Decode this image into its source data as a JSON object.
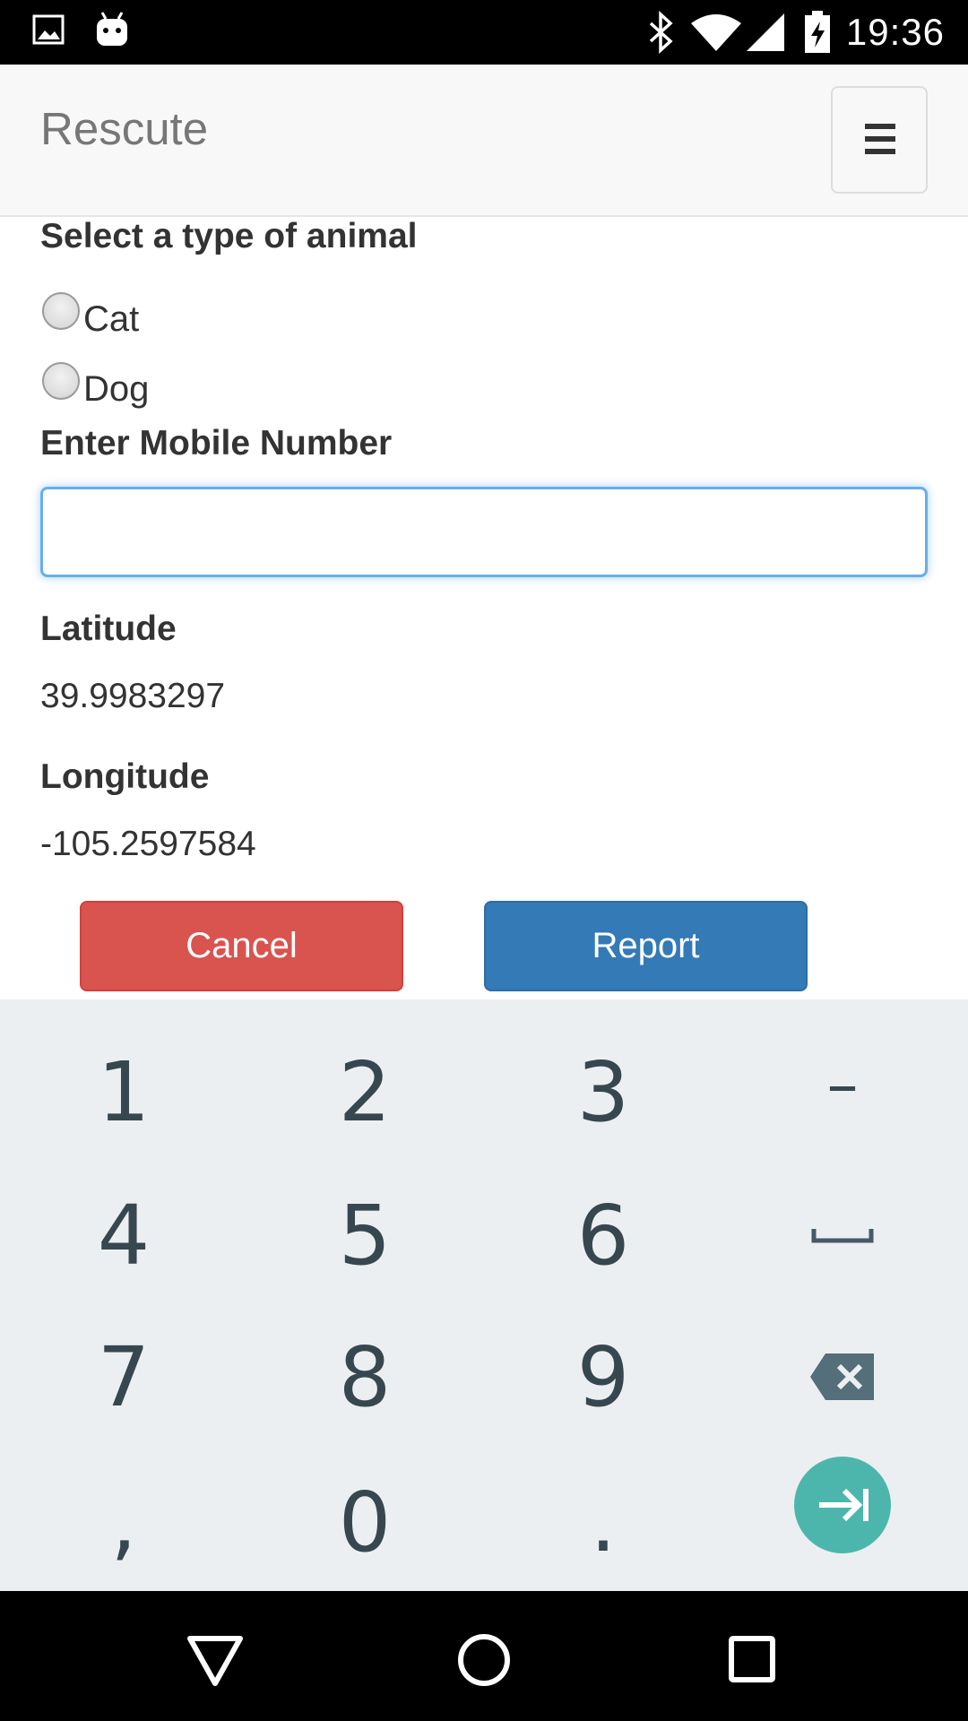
{
  "status_bar": {
    "time": "19:36",
    "icons": [
      "image-icon",
      "android-icon",
      "bluetooth-icon",
      "wifi-icon",
      "signal-icon",
      "battery-charging-icon"
    ]
  },
  "navbar": {
    "brand": "Rescute",
    "menu_icon": "hamburger-menu-icon"
  },
  "form": {
    "animal_label": "Select a type of animal",
    "animal_options": [
      {
        "label": "Cat",
        "selected": false
      },
      {
        "label": "Dog",
        "selected": false
      }
    ],
    "mobile_label": "Enter Mobile Number",
    "mobile_value": "",
    "latitude_label": "Latitude",
    "latitude_value": "39.9983297",
    "longitude_label": "Longitude",
    "longitude_value": "-105.2597584"
  },
  "buttons": {
    "cancel": "Cancel",
    "report": "Report",
    "cancel_color": "#d9534f",
    "report_color": "#337ab7"
  },
  "keyboard": {
    "rows": [
      [
        "1",
        "2",
        "3",
        "–"
      ],
      [
        "4",
        "5",
        "6",
        "space-icon"
      ],
      [
        "7",
        "8",
        "9",
        "backspace-icon"
      ],
      [
        ",",
        "0",
        ".",
        "next-icon"
      ]
    ],
    "accent": "#4db6ac"
  },
  "nav_bar": {
    "icons": [
      "back-icon",
      "home-icon",
      "recents-icon"
    ]
  }
}
